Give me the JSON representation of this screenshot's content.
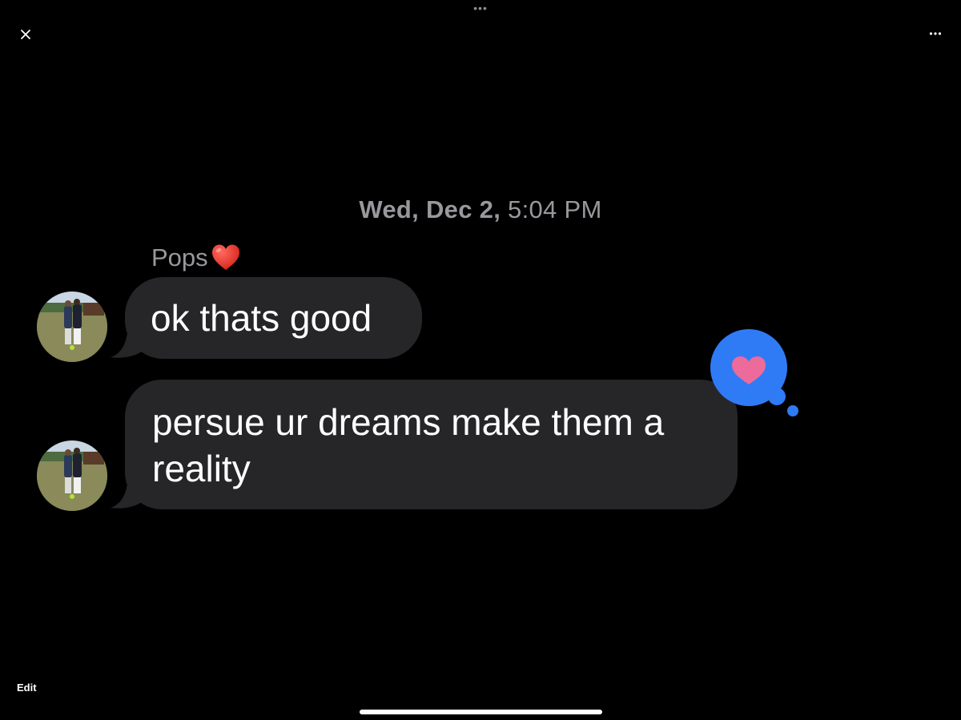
{
  "header": {
    "grabber_label": "•••",
    "close_icon": "close-icon",
    "more_icon": "more-horizontal-icon"
  },
  "conversation": {
    "timestamp_day": "Wed, Dec 2,",
    "timestamp_time": "5:04 PM",
    "sender": {
      "name": "Pops",
      "emoji_icon": "red-heart-icon"
    },
    "messages": [
      {
        "text": "ok thats good"
      },
      {
        "line1": "persue ur dreams make them a",
        "line2": "reality",
        "reaction_icon": "heart-reaction-icon"
      }
    ]
  },
  "footer": {
    "edit_label": "Edit"
  },
  "colors": {
    "background": "#000000",
    "bubble": "#262629",
    "secondary_text": "#98989d",
    "reaction_blue": "#2f7bf6",
    "reaction_heart": "#ec6b9a",
    "red_heart": "#e8352c"
  }
}
